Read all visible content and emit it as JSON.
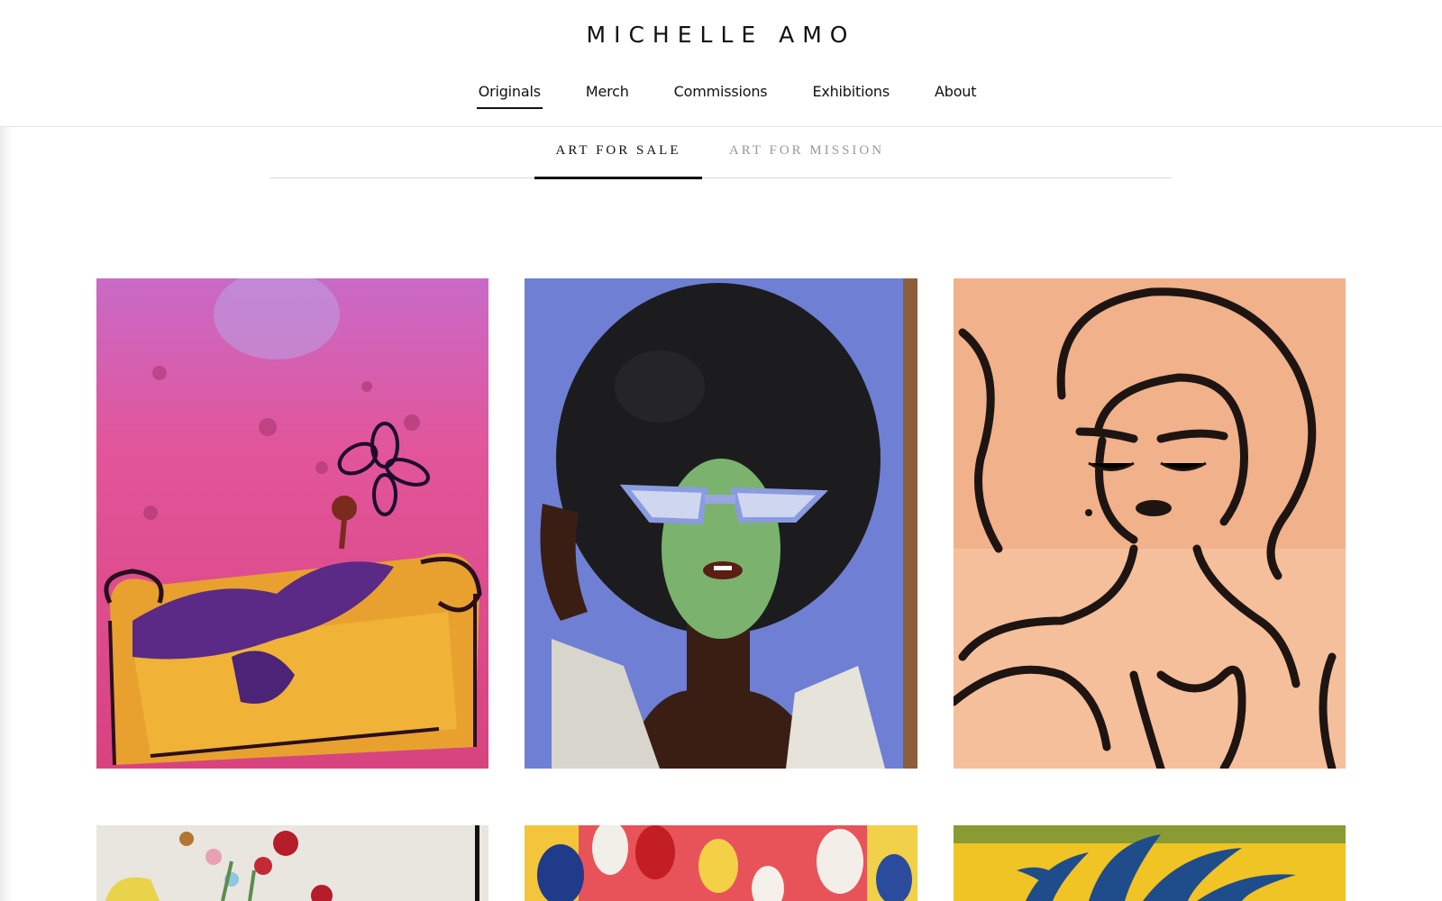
{
  "site": {
    "brand": "MICHELLE AMO"
  },
  "nav": {
    "items": [
      {
        "label": "Originals",
        "active": true
      },
      {
        "label": "Merch",
        "active": false
      },
      {
        "label": "Commissions",
        "active": false
      },
      {
        "label": "Exhibitions",
        "active": false
      },
      {
        "label": "About",
        "active": false
      }
    ]
  },
  "subtabs": {
    "items": [
      {
        "label": "ART FOR SALE",
        "active": true
      },
      {
        "label": "ART FOR MISSION",
        "active": false
      }
    ]
  },
  "gallery": {
    "items": [
      {
        "subject": "pink-flower-sofa-painting"
      },
      {
        "subject": "afro-woman-green-mask-painting"
      },
      {
        "subject": "line-portrait-woman-painting"
      },
      {
        "subject": "flower-vase-painting"
      },
      {
        "subject": "tulips-painting"
      },
      {
        "subject": "blue-plant-yellow-painting"
      }
    ]
  }
}
